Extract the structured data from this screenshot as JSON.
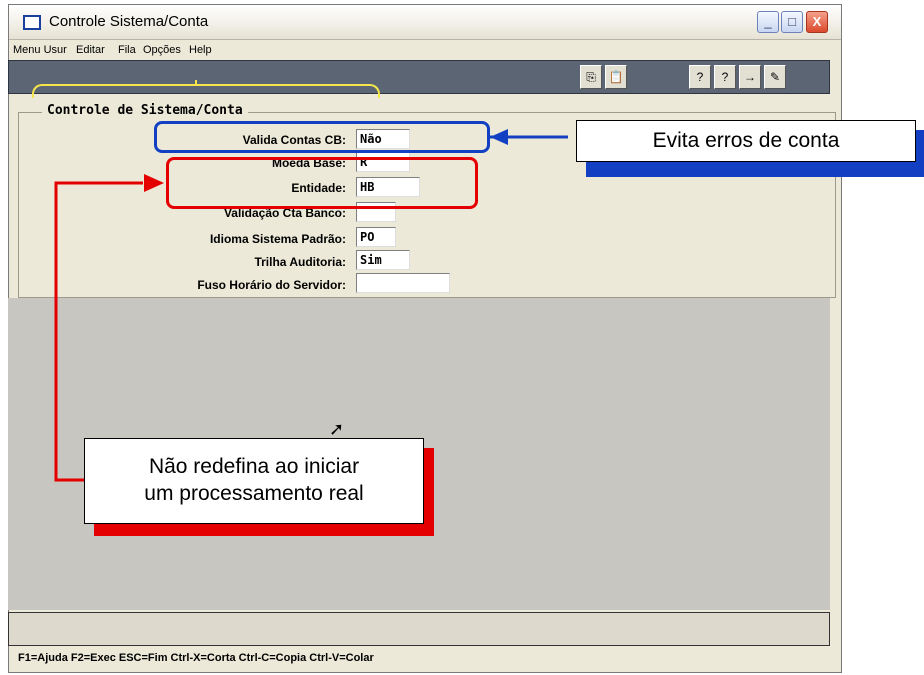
{
  "window": {
    "title": "Controle Sistema/Conta",
    "buttons": {
      "minimize": "_",
      "maximize": "□",
      "close": "X"
    }
  },
  "menu": [
    "Menu Usur",
    "Editar",
    "Fila",
    "Opções",
    "Help"
  ],
  "toolbar": {
    "icons": [
      "copy-icon",
      "paste-icon",
      "help-query-icon",
      "help-edit-icon",
      "help-next-icon",
      "help-exec-icon"
    ],
    "glyphs": [
      "⎘",
      "📋",
      "?",
      "?",
      "→",
      "✎"
    ]
  },
  "form": {
    "group_title": "Controle de Sistema/Conta",
    "fields": [
      {
        "label": "Valida Contas CB:",
        "value": "Não"
      },
      {
        "label": "Moeda Base:",
        "value": "R"
      },
      {
        "label": "Entidade:",
        "value": "HB"
      },
      {
        "label": "Validação Cta Banco:",
        "value": ""
      },
      {
        "label": "Idioma Sistema Padrão:",
        "value": "PO"
      },
      {
        "label": "Trilha Auditoria:",
        "value": "Sim"
      },
      {
        "label": "Fuso Horário do Servidor:",
        "value": ""
      }
    ]
  },
  "statusbar": {
    "hints": "F1=Ajuda F2=Exec ESC=Fim Ctrl-X=Corta Ctrl-C=Copia Ctrl-V=Colar"
  },
  "annotations": {
    "blue_callout": "Evita erros de conta",
    "red_callout_line1": "Não redefina ao iniciar",
    "red_callout_line2": "um processamento real",
    "colors": {
      "blue": "#1340c3",
      "red": "#e40000",
      "yellow": "#f6e64c"
    }
  }
}
